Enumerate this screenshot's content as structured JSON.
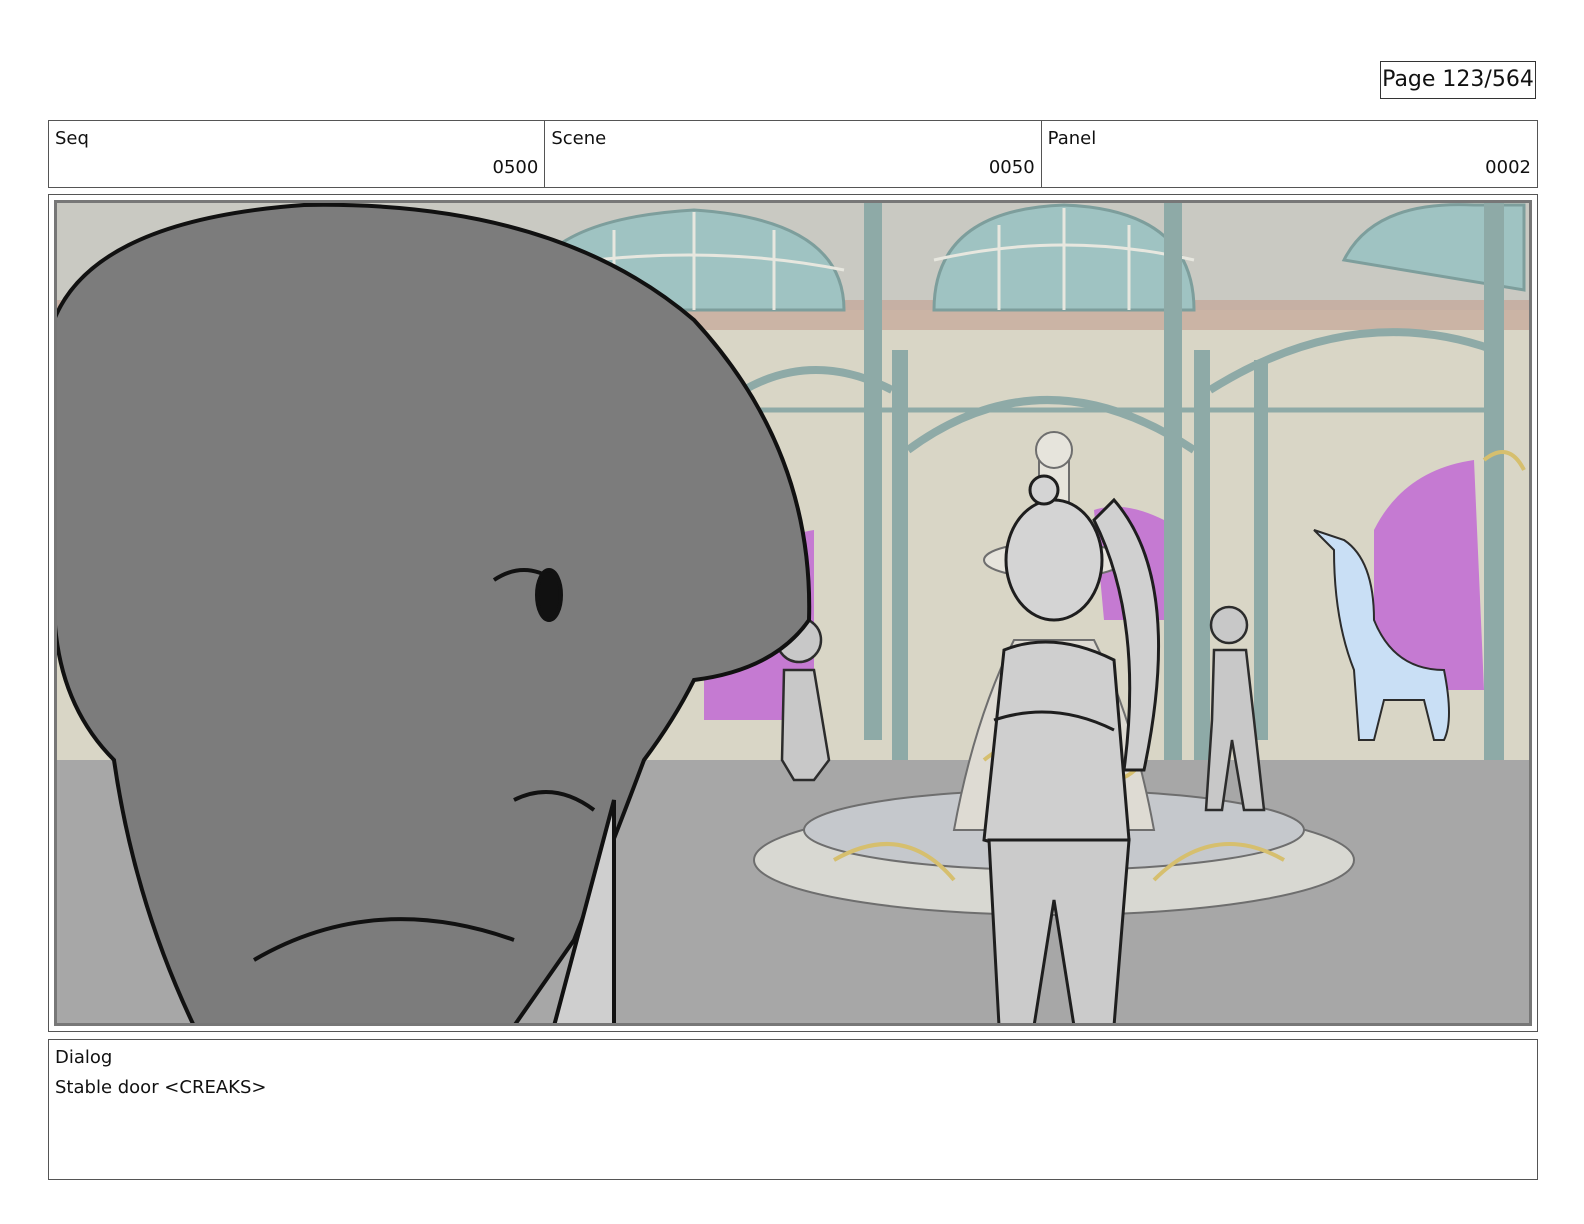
{
  "page": {
    "label": "Page 123/564"
  },
  "header": {
    "seq": {
      "label": "Seq",
      "value": "0500"
    },
    "scene": {
      "label": "Scene",
      "value": "0050"
    },
    "panel": {
      "label": "Panel",
      "value": "0002"
    }
  },
  "frame": {
    "description_icons": [
      "rotunda-background",
      "foreground-character-head",
      "ponytail-girl",
      "pigtail-girl",
      "standing-girl",
      "fountain",
      "ghost-unicorn"
    ],
    "colors": {
      "wall": "#d9d6c6",
      "window_glass": "#9fc3c2",
      "arch_trim": "#c4a597",
      "pillar": "#8eaaa7",
      "magenta_door": "#c57ad2",
      "floor": "#a7a7a7",
      "head_fill": "#7c7c7c",
      "unicorn": "#c9dff5"
    }
  },
  "dialog": {
    "label": "Dialog",
    "text": "Stable door <CREAKS>"
  }
}
